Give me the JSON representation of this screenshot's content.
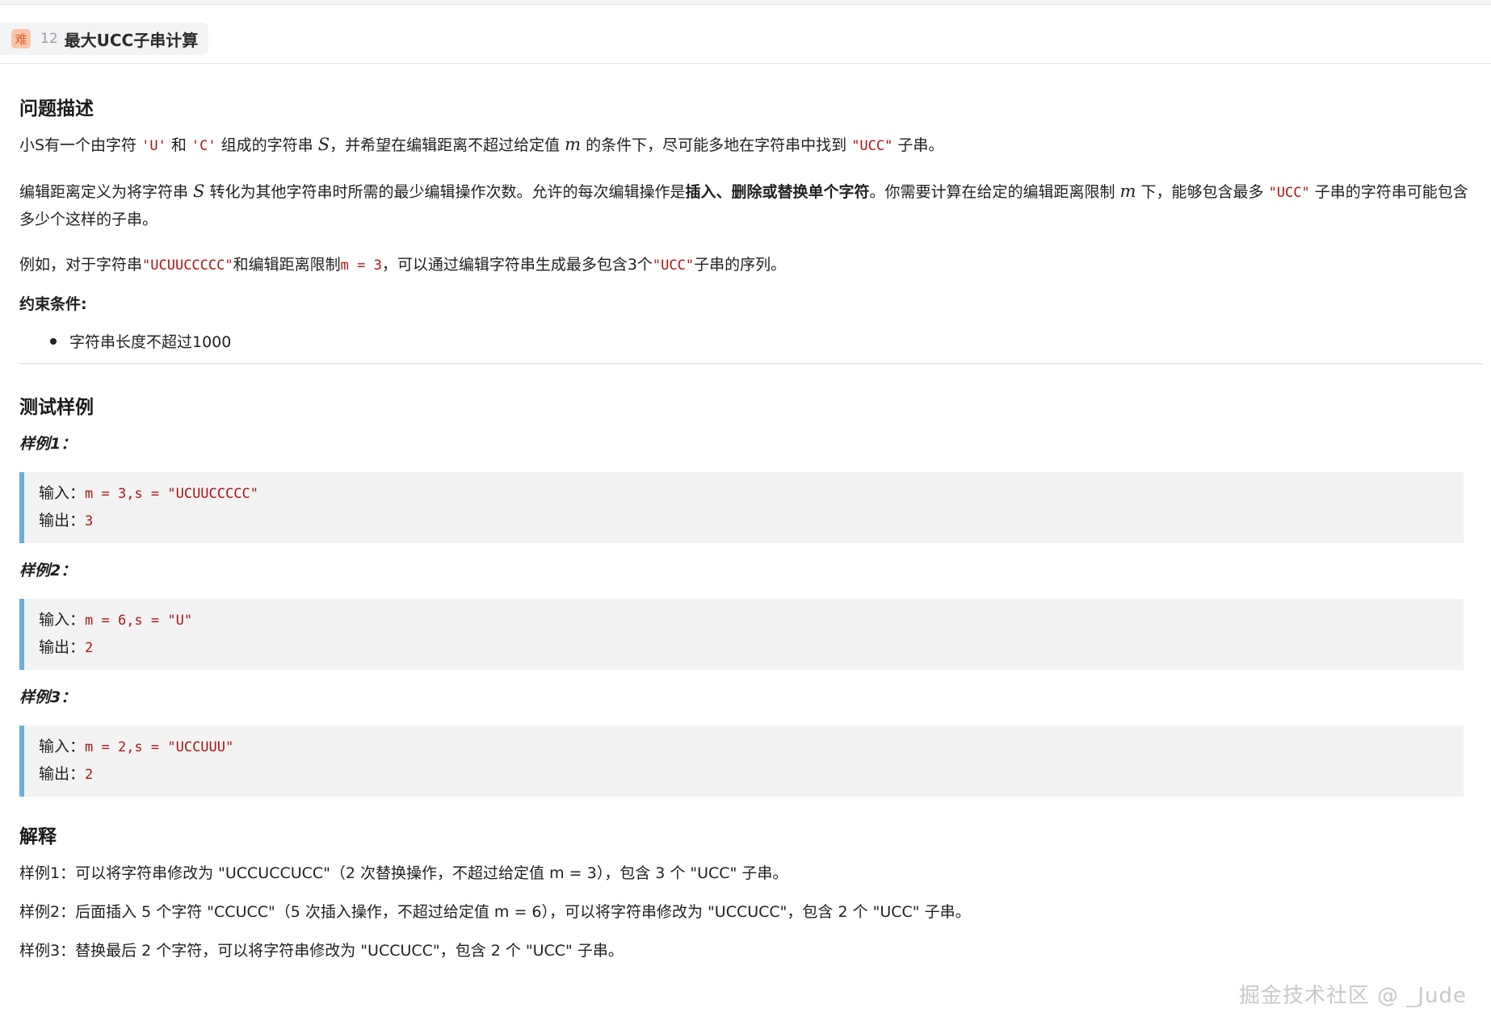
{
  "header": {
    "difficulty_badge": "难",
    "question_number": "12",
    "question_title": "最大UCC子串计算"
  },
  "description": {
    "heading": "问题描述",
    "p1": {
      "t1": "小S有一个由字符 ",
      "c1": "'U'",
      "t2": " 和 ",
      "c2": "'C'",
      "t3": " 组成的字符串 ",
      "m1": "S",
      "t4": "，并希望在编辑距离不超过给定值 ",
      "m2": "m",
      "t5": " 的条件下，尽可能多地在字符串中找到 ",
      "c3": "\"UCC\"",
      "t6": " 子串。"
    },
    "p2": {
      "t1": "编辑距离定义为将字符串 ",
      "m1": "S",
      "t2": " 转化为其他字符串时所需的最少编辑操作次数。允许的每次编辑操作是",
      "b1": "插入、删除或替换单个字符",
      "t3": "。你需要计算在给定的编辑距离限制 ",
      "m2": "m",
      "t4": " 下，能够包含最多 ",
      "c1": "\"UCC\"",
      "t5": " 子串的字符串可能包含多少个这样的子串。"
    },
    "p3": {
      "t1": "例如，对于字符串",
      "c1": "\"UCUUCCCCC\"",
      "t2": "和编辑距离限制",
      "c2": "m = 3",
      "t3": "，可以通过编辑字符串生成最多包含3个",
      "c3": "\"UCC\"",
      "t4": "子串的序列。"
    },
    "constraints_heading": "约束条件:",
    "constraints": [
      "字符串长度不超过1000"
    ]
  },
  "samples": {
    "heading": "测试样例",
    "input_label": "输入：",
    "output_label": "输出：",
    "items": [
      {
        "label": "样例1：",
        "input": "m = 3,s = \"UCUUCCCCC\"",
        "output": "3"
      },
      {
        "label": "样例2：",
        "input": "m = 6,s = \"U\"",
        "output": "2"
      },
      {
        "label": "样例3：",
        "input": "m = 2,s = \"UCCUUU\"",
        "output": "2"
      }
    ]
  },
  "explanation": {
    "heading": "解释",
    "lines": [
      "样例1：可以将字符串修改为 \"UCCUCCUCC\"（2 次替换操作，不超过给定值 m = 3），包含 3 个 \"UCC\" 子串。",
      "样例2：后面插入 5 个字符 \"CCUCC\"（5 次插入操作，不超过给定值 m = 6），可以将字符串修改为 \"UCCUCC\"，包含 2 个 \"UCC\" 子串。",
      "样例3：替换最后 2 个字符，可以将字符串修改为 \"UCCUCC\"，包含 2 个 \"UCC\" 子串。"
    ]
  },
  "watermark": "掘金技术社区 @ _Jude"
}
